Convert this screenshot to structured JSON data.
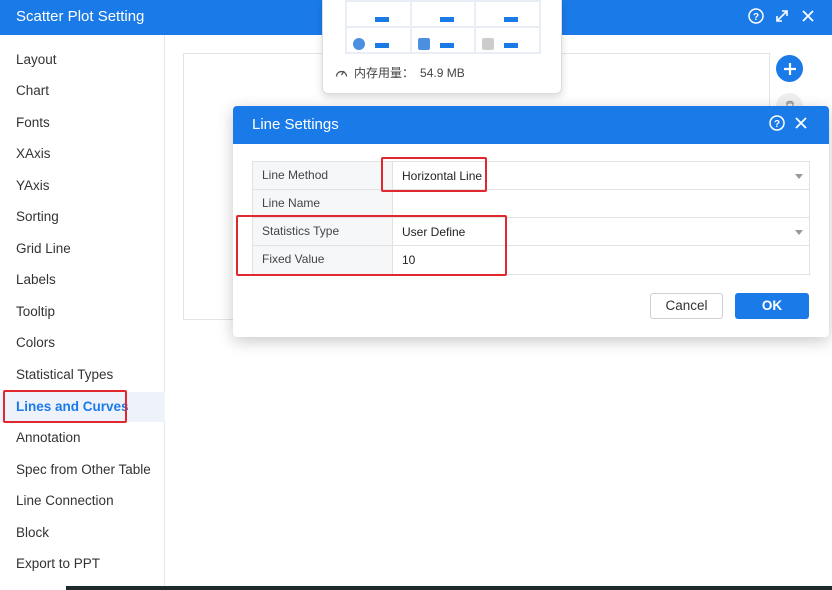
{
  "window": {
    "title": "Scatter Plot Setting",
    "controls": [
      "help-icon",
      "expand-icon",
      "close-icon"
    ]
  },
  "sidebar": {
    "items": [
      {
        "label": "Layout"
      },
      {
        "label": "Chart"
      },
      {
        "label": "Fonts"
      },
      {
        "label": "XAxis"
      },
      {
        "label": "YAxis"
      },
      {
        "label": "Sorting"
      },
      {
        "label": "Grid Line"
      },
      {
        "label": "Labels"
      },
      {
        "label": "Tooltip"
      },
      {
        "label": "Colors"
      },
      {
        "label": "Statistical Types"
      },
      {
        "label": "Lines and Curves",
        "active": true
      },
      {
        "label": "Annotation"
      },
      {
        "label": "Spec from Other Table"
      },
      {
        "label": "Line Connection"
      },
      {
        "label": "Block"
      },
      {
        "label": "Export to PPT"
      }
    ]
  },
  "popup": {
    "memory_label": "内存用量：",
    "memory_value": "54.9 MB"
  },
  "dialog": {
    "title": "Line Settings",
    "fields": [
      {
        "label": "Line Method",
        "value": "Horizontal Line",
        "type": "select"
      },
      {
        "label": "Line Name",
        "value": "",
        "type": "text"
      },
      {
        "label": "Statistics Type",
        "value": "User Define",
        "type": "select"
      },
      {
        "label": "Fixed Value",
        "value": "10",
        "type": "text"
      }
    ],
    "cancel_label": "Cancel",
    "ok_label": "OK"
  },
  "colors": {
    "accent": "#1a7ae8",
    "highlight": "#e0282e"
  }
}
